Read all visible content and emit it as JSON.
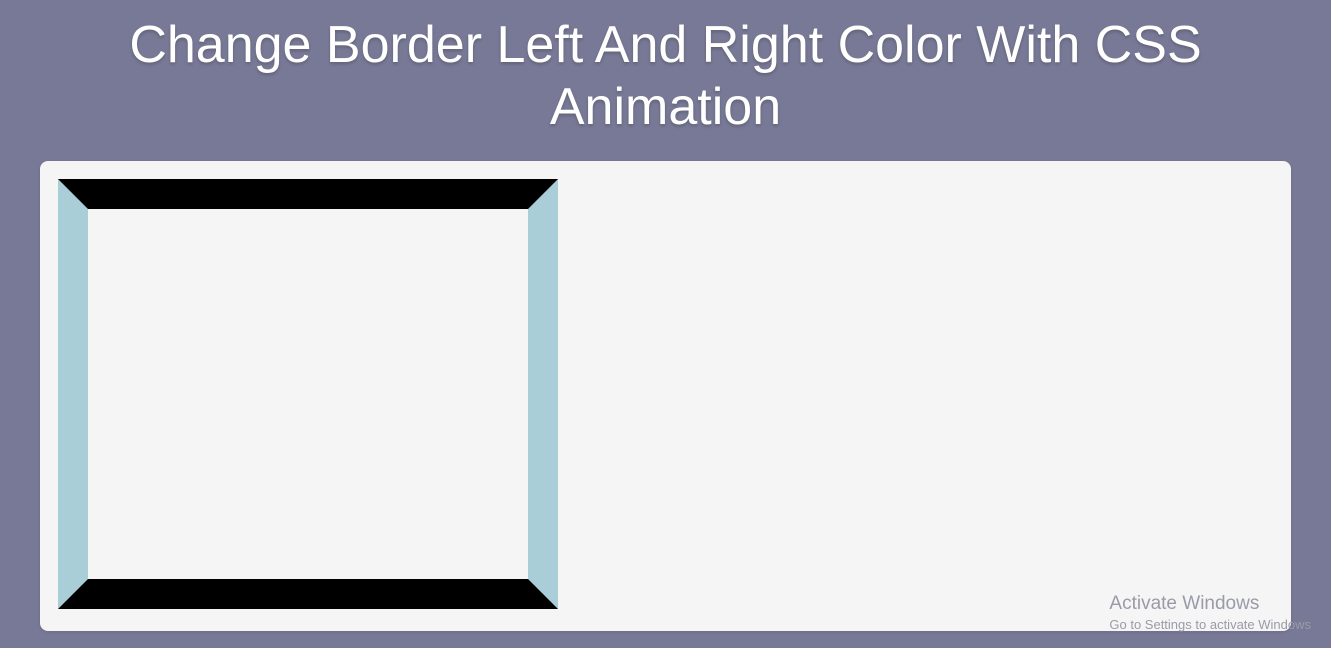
{
  "header": {
    "title": "Change Border Left And Right Color With CSS Animation"
  },
  "demo": {
    "borderTopColor": "#000000",
    "borderBottomColor": "#000000",
    "borderLeftColor": "#a9ced8",
    "borderRightColor": "#a9ced8"
  },
  "watermark": {
    "title": "Activate Windows",
    "subtitle": "Go to Settings to activate Windows"
  }
}
